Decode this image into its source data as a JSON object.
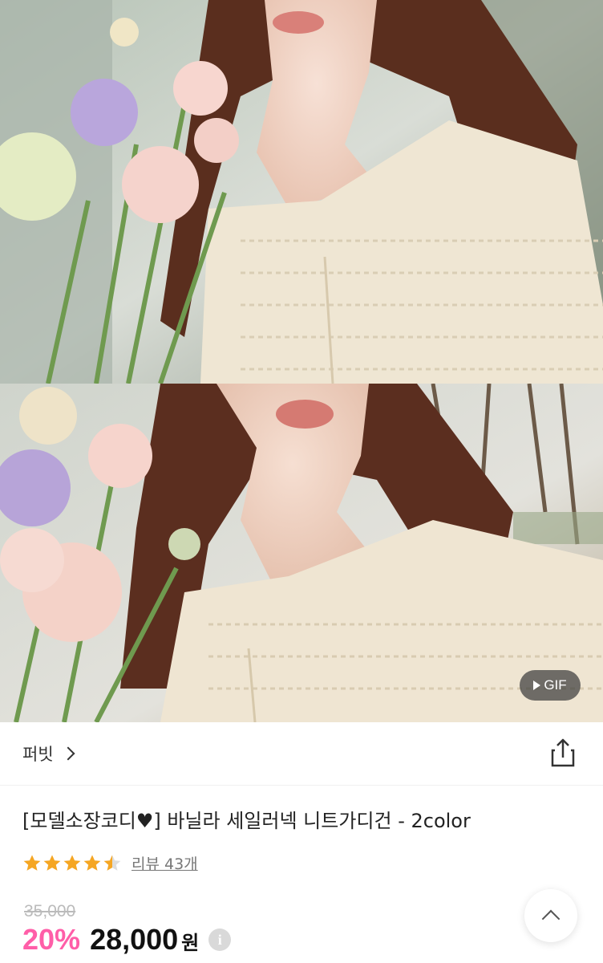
{
  "gallery": {
    "photos": [
      {
        "alt": "photo-1"
      },
      {
        "alt": "photo-2"
      }
    ],
    "gif_label": "GIF"
  },
  "store": {
    "name": "퍼빗"
  },
  "product": {
    "title": "[모델소장코디♥]  바닐라 세일러넥 니트가디건 - 2color",
    "rating_value": 4.5,
    "rating_max": 5,
    "review_label": "리뷰 43개",
    "original_price": "35,000",
    "discount": "20%",
    "price": "28,000",
    "currency": "원",
    "info_icon": "i"
  },
  "colors": {
    "accent_pink": "#ff5ea8",
    "star": "#f5a623",
    "star_empty": "#dddddd"
  },
  "icons": {
    "share": "share-icon",
    "scroll_top": "chevron-up-icon",
    "store_chevron": "chevron-right-icon",
    "gif_play": "play-icon"
  }
}
